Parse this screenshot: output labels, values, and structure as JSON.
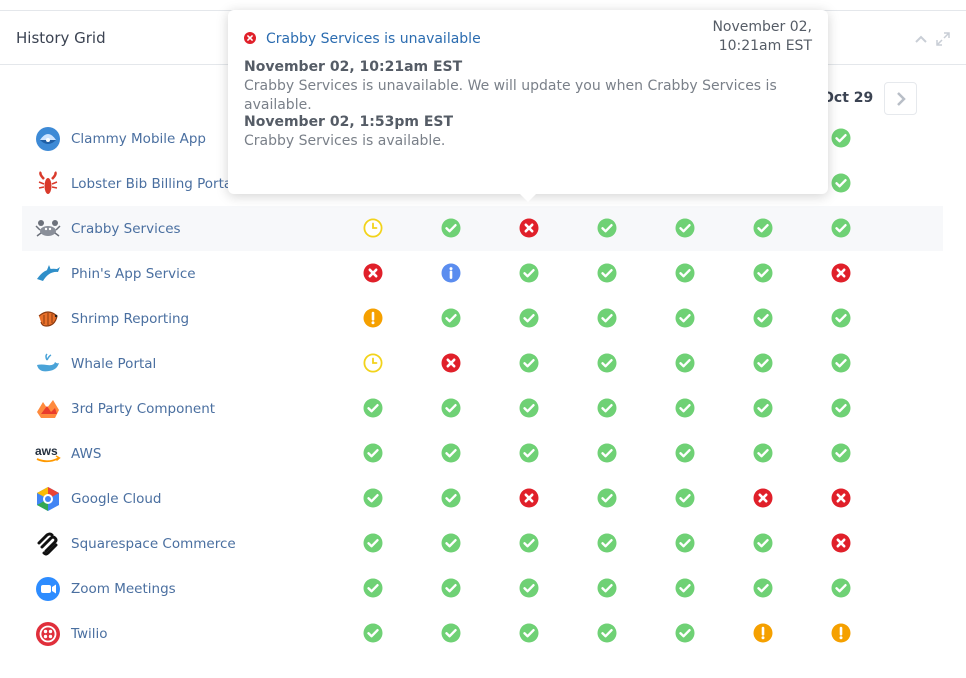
{
  "panel": {
    "title": "History Grid"
  },
  "grid": {
    "date_label": "Oct 29",
    "services": [
      {
        "name": "Clammy Mobile App",
        "logo": "clam-logo",
        "statuses": [
          "",
          "",
          "",
          "",
          "",
          "",
          "ok"
        ]
      },
      {
        "name": "Lobster Bib Billing Portal",
        "logo": "lobster-logo",
        "statuses": [
          "",
          "",
          "",
          "",
          "",
          "",
          "ok"
        ]
      },
      {
        "name": "Crabby Services",
        "logo": "crab-logo",
        "statuses": [
          "maintenance",
          "ok",
          "outage",
          "ok",
          "ok",
          "ok",
          "ok"
        ]
      },
      {
        "name": "Phin's App Service",
        "logo": "dolphin-logo",
        "statuses": [
          "outage",
          "info",
          "ok",
          "ok",
          "ok",
          "ok",
          "outage"
        ]
      },
      {
        "name": "Shrimp Reporting",
        "logo": "shrimp-logo",
        "statuses": [
          "warning",
          "ok",
          "ok",
          "ok",
          "ok",
          "ok",
          "ok"
        ]
      },
      {
        "name": "Whale Portal",
        "logo": "whale-logo",
        "statuses": [
          "maintenance",
          "outage",
          "ok",
          "ok",
          "ok",
          "ok",
          "ok"
        ]
      },
      {
        "name": "3rd Party Component",
        "logo": "component-logo",
        "statuses": [
          "ok",
          "ok",
          "ok",
          "ok",
          "ok",
          "ok",
          "ok"
        ]
      },
      {
        "name": "AWS",
        "logo": "aws-logo",
        "logo_text": "aws",
        "statuses": [
          "ok",
          "ok",
          "ok",
          "ok",
          "ok",
          "ok",
          "ok"
        ]
      },
      {
        "name": "Google Cloud",
        "logo": "google-cloud-logo",
        "statuses": [
          "ok",
          "ok",
          "outage",
          "ok",
          "ok",
          "outage",
          "outage"
        ]
      },
      {
        "name": "Squarespace Commerce",
        "logo": "squarespace-logo",
        "statuses": [
          "ok",
          "ok",
          "ok",
          "ok",
          "ok",
          "ok",
          "outage"
        ]
      },
      {
        "name": "Zoom Meetings",
        "logo": "zoom-logo",
        "statuses": [
          "ok",
          "ok",
          "ok",
          "ok",
          "ok",
          "ok",
          "ok"
        ]
      },
      {
        "name": "Twilio",
        "logo": "twilio-logo",
        "statuses": [
          "ok",
          "ok",
          "ok",
          "ok",
          "ok",
          "warning",
          "warning"
        ]
      }
    ]
  },
  "tooltip": {
    "title": "Crabby Services is unavailable",
    "date_line1": "November 02,",
    "date_line2": "10:21am EST",
    "entries": [
      {
        "when": "November 02, 10:21am EST",
        "message": "Crabby Services is unavailable. We will update you when Crabby Services is available."
      },
      {
        "when": "November 02, 1:53pm EST",
        "message": "Crabby Services is available."
      }
    ]
  },
  "colors": {
    "ok": "#6fd175",
    "outage": "#e0202a",
    "warning": "#f5a000",
    "maintenance": "#f2d31b",
    "info": "#5b8def",
    "link": "#4a6fa0",
    "tooltip_title": "#2b6cb0"
  }
}
